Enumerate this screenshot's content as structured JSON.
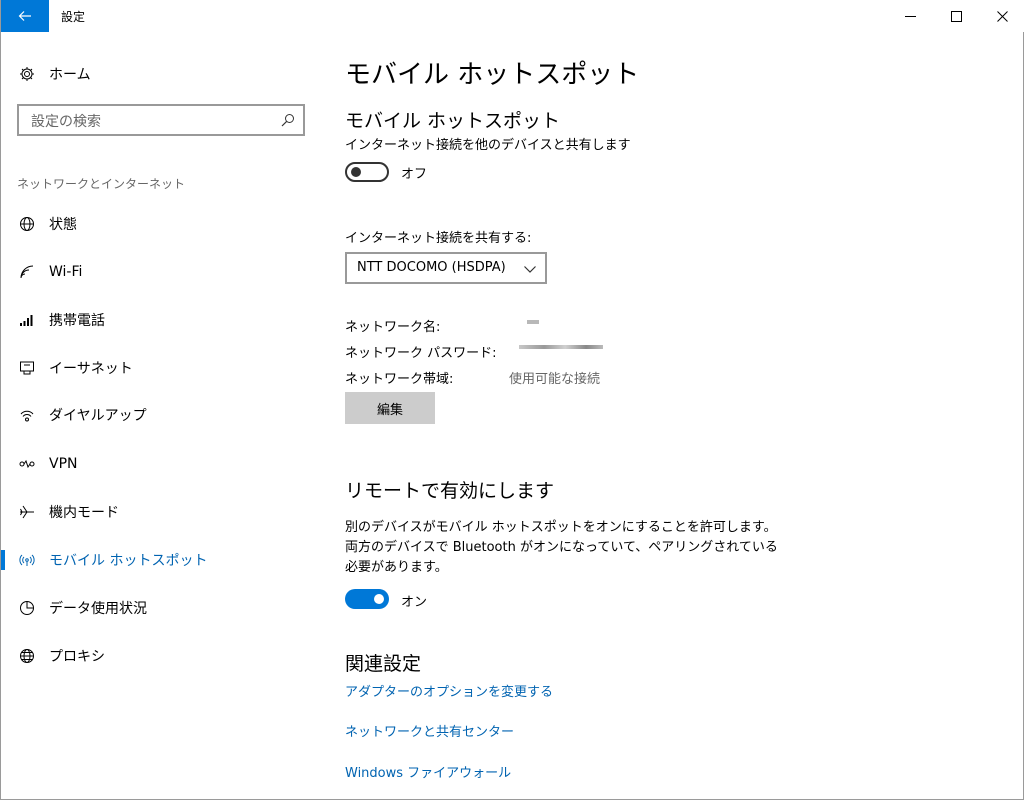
{
  "window": {
    "title": "設定"
  },
  "sidebar": {
    "home_label": "ホーム",
    "search_placeholder": "設定の検索",
    "section_label": "ネットワークとインターネット",
    "items": [
      {
        "label": "状態",
        "icon": "globe-status-icon"
      },
      {
        "label": "Wi-Fi",
        "icon": "wifi-icon"
      },
      {
        "label": "携帯電話",
        "icon": "cellular-signal-icon"
      },
      {
        "label": "イーサネット",
        "icon": "ethernet-icon"
      },
      {
        "label": "ダイヤルアップ",
        "icon": "dialup-icon"
      },
      {
        "label": "VPN",
        "icon": "vpn-icon"
      },
      {
        "label": "機内モード",
        "icon": "airplane-icon"
      },
      {
        "label": "モバイル ホットスポット",
        "icon": "hotspot-icon",
        "active": true
      },
      {
        "label": "データ使用状況",
        "icon": "data-usage-icon"
      },
      {
        "label": "プロキシ",
        "icon": "globe-proxy-icon"
      }
    ]
  },
  "main": {
    "page_title": "モバイル ホットスポット",
    "hotspot": {
      "heading": "モバイル ホットスポット",
      "description": "インターネット接続を他のデバイスと共有します",
      "toggle_state": "オフ"
    },
    "share": {
      "label": "インターネット接続を共有する:",
      "selected": "NTT DOCOMO (HSDPA)"
    },
    "info": {
      "network_name_label": "ネットワーク名:",
      "password_label": "ネットワーク パスワード:",
      "band_label": "ネットワーク帯域:",
      "band_value": "使用可能な接続"
    },
    "edit_label": "編集",
    "remote": {
      "heading": "リモートで有効にします",
      "paragraph": "別のデバイスがモバイル ホットスポットをオンにすることを許可します。両方のデバイスで Bluetooth がオンになっていて、ペアリングされている必要があります。",
      "toggle_state": "オン"
    },
    "related": {
      "heading": "関連設定",
      "links": [
        "アダプターのオプションを変更する",
        "ネットワークと共有センター",
        "Windows ファイアウォール"
      ]
    }
  },
  "colors": {
    "accent": "#0078d7",
    "link": "#0063b1"
  }
}
